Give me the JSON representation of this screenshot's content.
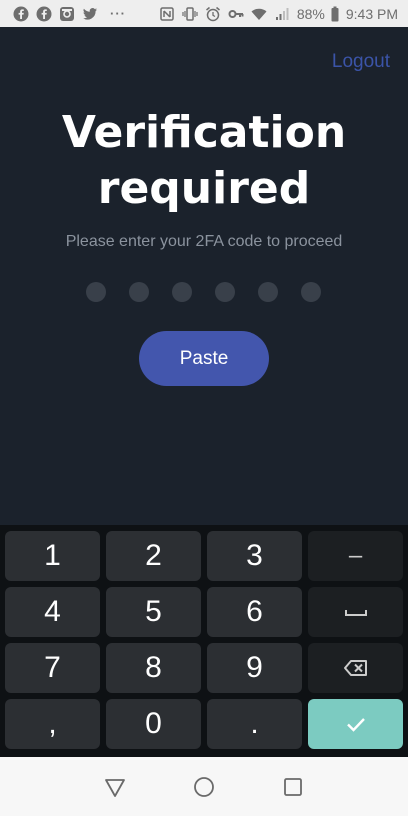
{
  "status_bar": {
    "battery": "88%",
    "time": "9:43 PM",
    "left_icons": [
      "facebook-icon",
      "facebook-icon",
      "instagram-icon",
      "twitter-icon"
    ],
    "more": "···",
    "right_icons": [
      "nfc-icon",
      "vibrate-icon",
      "alarm-icon",
      "key-icon",
      "wifi-icon",
      "signal-icon",
      "battery-icon"
    ]
  },
  "header": {
    "logout_label": "Logout"
  },
  "main": {
    "title_line1": "Verification",
    "title_line2": "required",
    "subtitle": "Please enter your 2FA code to proceed",
    "code_digits_entered": 0,
    "code_length": 6,
    "paste_label": "Paste"
  },
  "keypad": {
    "keys": [
      "1",
      "2",
      "3",
      "–",
      "4",
      "5",
      "6",
      "space",
      "7",
      "8",
      "9",
      "backspace",
      ",",
      "0",
      ".",
      "enter"
    ],
    "labels": {
      "k1": "1",
      "k2": "2",
      "k3": "3",
      "minus": "–",
      "k4": "4",
      "k5": "5",
      "k6": "6",
      "k7": "7",
      "k8": "8",
      "k9": "9",
      "comma": ",",
      "k0": "0",
      "period": "."
    }
  },
  "colors": {
    "background": "#1b222c",
    "accent": "#4356ad",
    "logout": "#3b54a8",
    "enter_key": "#7ccbc1"
  },
  "nav_bar": {
    "buttons": [
      "back-icon",
      "home-icon",
      "recents-icon"
    ]
  }
}
